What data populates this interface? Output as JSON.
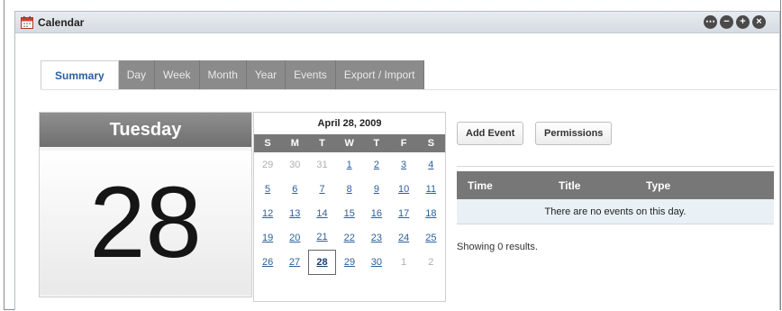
{
  "window": {
    "title": "Calendar",
    "controls": [
      "more",
      "minimize",
      "maximize",
      "close"
    ]
  },
  "tabs": [
    {
      "label": "Summary",
      "active": true
    },
    {
      "label": "Day",
      "active": false
    },
    {
      "label": "Week",
      "active": false
    },
    {
      "label": "Month",
      "active": false
    },
    {
      "label": "Year",
      "active": false
    },
    {
      "label": "Events",
      "active": false
    },
    {
      "label": "Export / Import",
      "active": false
    }
  ],
  "day_card": {
    "weekday": "Tuesday",
    "day": "28"
  },
  "mini_calendar": {
    "month_label": "April 28, 2009",
    "weekdays": [
      "S",
      "M",
      "T",
      "W",
      "T",
      "F",
      "S"
    ],
    "weeks": [
      [
        {
          "d": "29",
          "muted": true
        },
        {
          "d": "30",
          "muted": true
        },
        {
          "d": "31",
          "muted": true
        },
        {
          "d": "1"
        },
        {
          "d": "2"
        },
        {
          "d": "3"
        },
        {
          "d": "4"
        }
      ],
      [
        {
          "d": "5"
        },
        {
          "d": "6"
        },
        {
          "d": "7"
        },
        {
          "d": "8"
        },
        {
          "d": "9"
        },
        {
          "d": "10"
        },
        {
          "d": "11"
        }
      ],
      [
        {
          "d": "12"
        },
        {
          "d": "13"
        },
        {
          "d": "14"
        },
        {
          "d": "15"
        },
        {
          "d": "16"
        },
        {
          "d": "17"
        },
        {
          "d": "18"
        }
      ],
      [
        {
          "d": "19"
        },
        {
          "d": "20"
        },
        {
          "d": "21"
        },
        {
          "d": "22"
        },
        {
          "d": "23"
        },
        {
          "d": "24"
        },
        {
          "d": "25"
        }
      ],
      [
        {
          "d": "26"
        },
        {
          "d": "27"
        },
        {
          "d": "28",
          "today": true
        },
        {
          "d": "29"
        },
        {
          "d": "30"
        },
        {
          "d": "1",
          "muted": true
        },
        {
          "d": "2",
          "muted": true
        }
      ]
    ]
  },
  "actions": {
    "add_event": "Add Event",
    "permissions": "Permissions"
  },
  "events_table": {
    "columns": [
      "Time",
      "Title",
      "Type"
    ],
    "empty_message": "There are no events on this day.",
    "results_text": "Showing 0 results."
  },
  "colors": {
    "link": "#2b5f9e",
    "header_gray": "#777777",
    "empty_row_bg": "#e9f1f6",
    "icon_red": "#d83a2c"
  }
}
